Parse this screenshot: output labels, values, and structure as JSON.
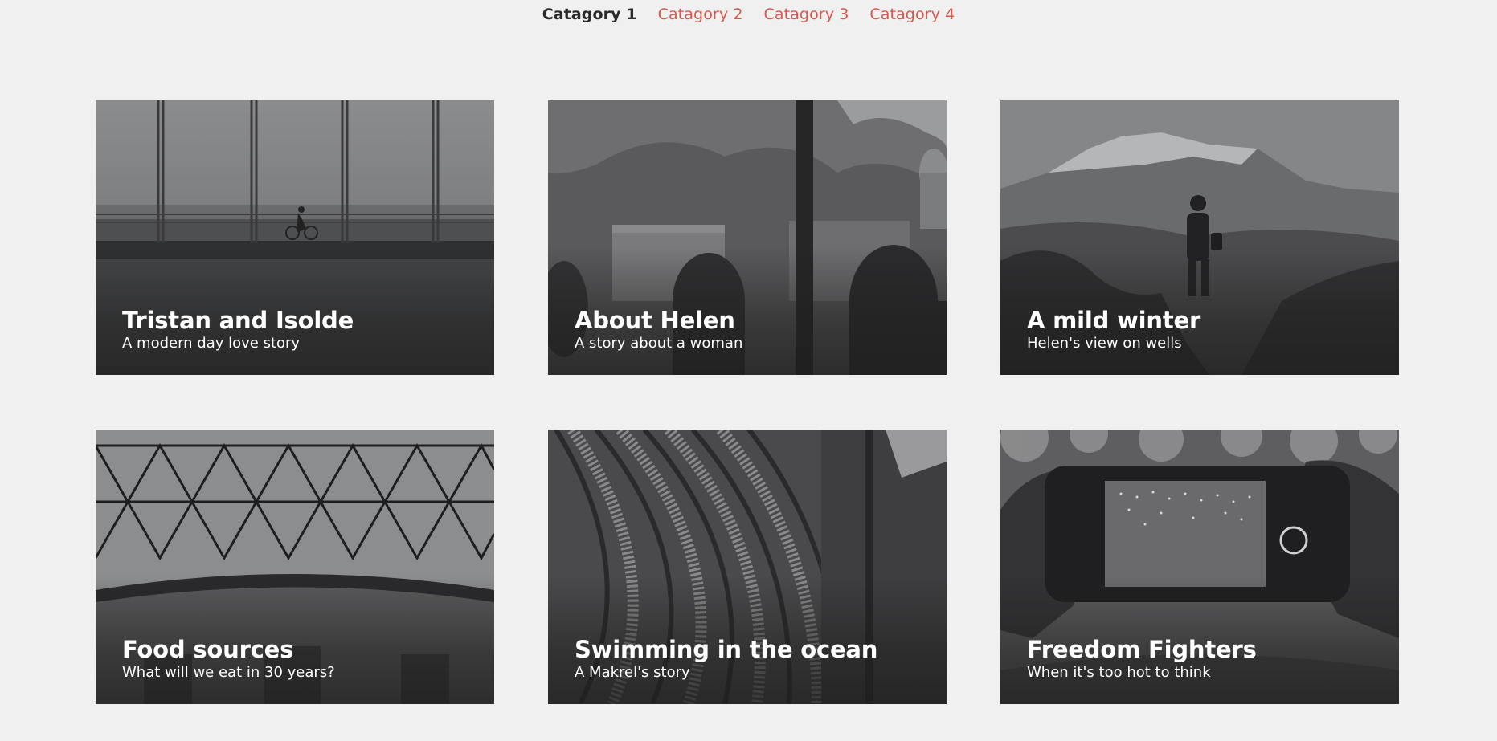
{
  "nav": {
    "items": [
      {
        "label": "Catagory 1",
        "active": true
      },
      {
        "label": "Catagory 2",
        "active": false
      },
      {
        "label": "Catagory 3",
        "active": false
      },
      {
        "label": "Catagory 4",
        "active": false
      }
    ]
  },
  "cards": [
    {
      "title": "Tristan and Isolde",
      "subtitle": "A modern day love story",
      "image": "bridge-cyclist-photo"
    },
    {
      "title": "About Helen",
      "subtitle": "A story about a woman",
      "image": "city-window-silhouettes-photo"
    },
    {
      "title": "A mild winter",
      "subtitle": "Helen's view on wells",
      "image": "mountain-hiker-photo"
    },
    {
      "title": "Food sources",
      "subtitle": "What will we eat in 30 years?",
      "image": "glass-dome-roof-photo"
    },
    {
      "title": "Swimming in the ocean",
      "subtitle": "A Makrel's story",
      "image": "library-bookshelves-photo"
    },
    {
      "title": "Freedom Fighters",
      "subtitle": "When it's too hot to think",
      "image": "phone-camera-lights-photo"
    }
  ],
  "colors": {
    "background": "#f0f0f0",
    "nav_active": "#2a2a2a",
    "nav_link": "#d9574a",
    "caption_text": "#ffffff"
  }
}
